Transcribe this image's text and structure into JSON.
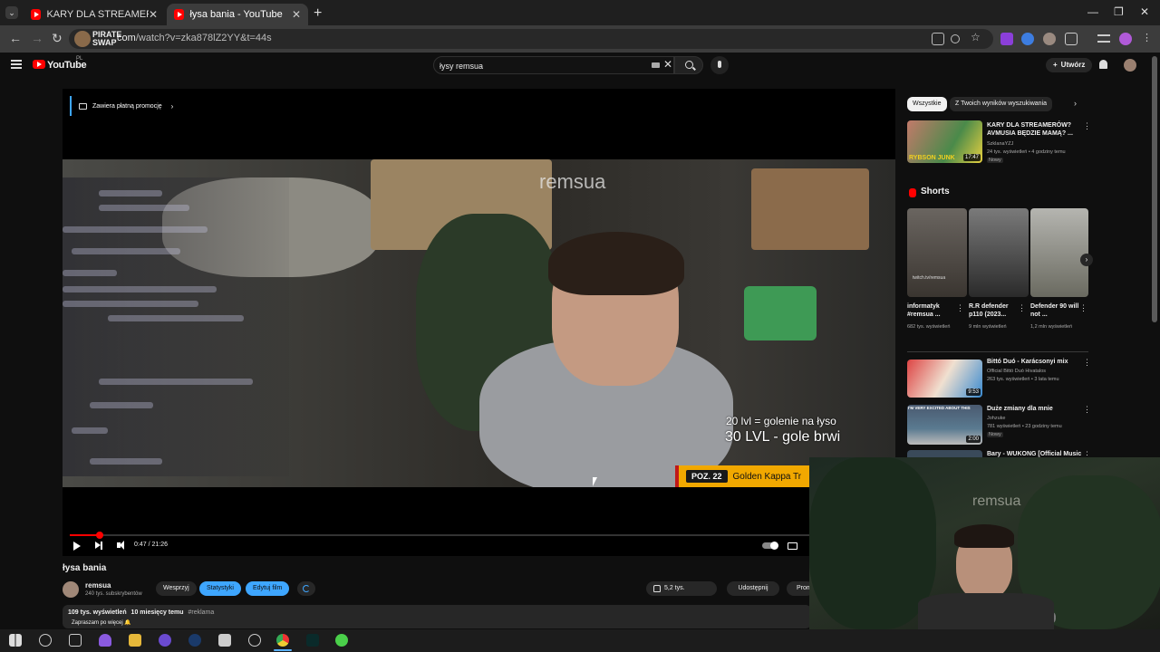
{
  "browser": {
    "tabs": [
      {
        "title": "KARY DLA STREAMERÓW? AVM",
        "active": false
      },
      {
        "title": "łysa bania - YouTube",
        "active": true
      }
    ],
    "url_domain": ".com",
    "url_path": "/watch?v=zka878lZ2YY&t=44s",
    "site_brand": "PIRATE SWAP"
  },
  "masthead": {
    "logo_text": "YouTube",
    "region": "PL",
    "search_value": "łysy remsua",
    "create_label": "Utwórz"
  },
  "player": {
    "promo_label": "Zawiera płatną promocję",
    "overlay_line1": "20 lvl  = golenie na łyso",
    "overlay_line2": "30 LVL - gole brwi",
    "poz_number": "POZ. 22",
    "poz_name": "Golden Kappa Tr",
    "video_sign": "remsua",
    "time": "0:47 / 21:26",
    "progress": 0.037
  },
  "video": {
    "title": "łysa bania",
    "channel": "remsua",
    "subscribers": "240 tys. subskrybentów",
    "support_label": "Wesprzyj",
    "stats_label": "Statystyki",
    "edit_label": "Edytuj film",
    "likes": "5,2 tys.",
    "share_label": "Udostępnij",
    "more_label": "Prom",
    "views": "109 tys. wyświetleń",
    "age": "10 miesięcy temu",
    "hashtag": "#reklama",
    "description": "Zapraszam po więcej 🔔"
  },
  "sidebar": {
    "chips": [
      "Wszystkie",
      "Z Twoich wyników wyszukiwania"
    ],
    "top_video": {
      "title": "KARY DLA STREAMERÓW? AVMUSIA BĘDZIE MAMĄ? ...",
      "channel": "SzklanaYZJ",
      "meta": "24 tys. wyświetleń • 4 godziny temu",
      "badge": "Nowy",
      "duration": "17:47",
      "thumb_text": "RYBSON JUNK"
    },
    "shorts_title": "Shorts",
    "shorts": [
      {
        "title": "informatyk #remsua ...",
        "views": "682 tys. wyświetleń",
        "thumb_text": "twitch.tv/remsua"
      },
      {
        "title": "R.R defender p110 (2023...",
        "views": "9 mln wyświetleń"
      },
      {
        "title": "Defender 90 will not ...",
        "views": "1,2 mln wyświetleń"
      }
    ],
    "videos": [
      {
        "title": "Bittó Duó - Karácsonyi mix",
        "channel": "Official Bittó Duó Hivatalos",
        "meta": "263 tys. wyświetleń • 3 lata temu",
        "duration": "9:53",
        "badge": ""
      },
      {
        "title": "Duże zmiany dla mnie",
        "channel": "Johzuke",
        "meta": "781 wyświetleń • 23 godziny temu",
        "duration": "2:00",
        "badge": "Nowy",
        "thumb_text": "I'M VERY EXCITED ABOUT THIS"
      },
      {
        "title": "Bary - WUKONG [Official Music",
        "channel": "",
        "meta": "",
        "duration": "",
        "badge": ""
      }
    ]
  },
  "webcam": {
    "sign": "remsua"
  },
  "colors": {
    "yt_red": "#ff0000",
    "accent_blue": "#3ea6ff",
    "background": "#0f0f0f"
  }
}
